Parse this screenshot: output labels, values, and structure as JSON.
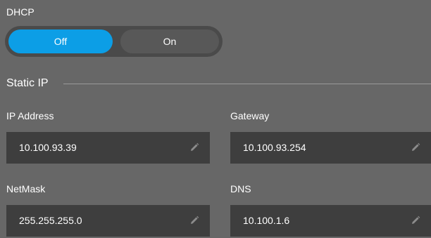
{
  "dhcp": {
    "label": "DHCP",
    "off_label": "Off",
    "on_label": "On",
    "selected": "Off",
    "accent_color": "#0c9ee6"
  },
  "static_ip": {
    "section_label": "Static IP",
    "ip_address": {
      "label": "IP Address",
      "value": "10.100.93.39",
      "icon": "pencil-icon"
    },
    "gateway": {
      "label": "Gateway",
      "value": "10.100.93.254",
      "icon": "pencil-icon"
    },
    "netmask": {
      "label": "NetMask",
      "value": "255.255.255.0",
      "icon": "pencil-icon"
    },
    "dns": {
      "label": "DNS",
      "value": "10.100.1.6",
      "icon": "pencil-icon"
    }
  }
}
